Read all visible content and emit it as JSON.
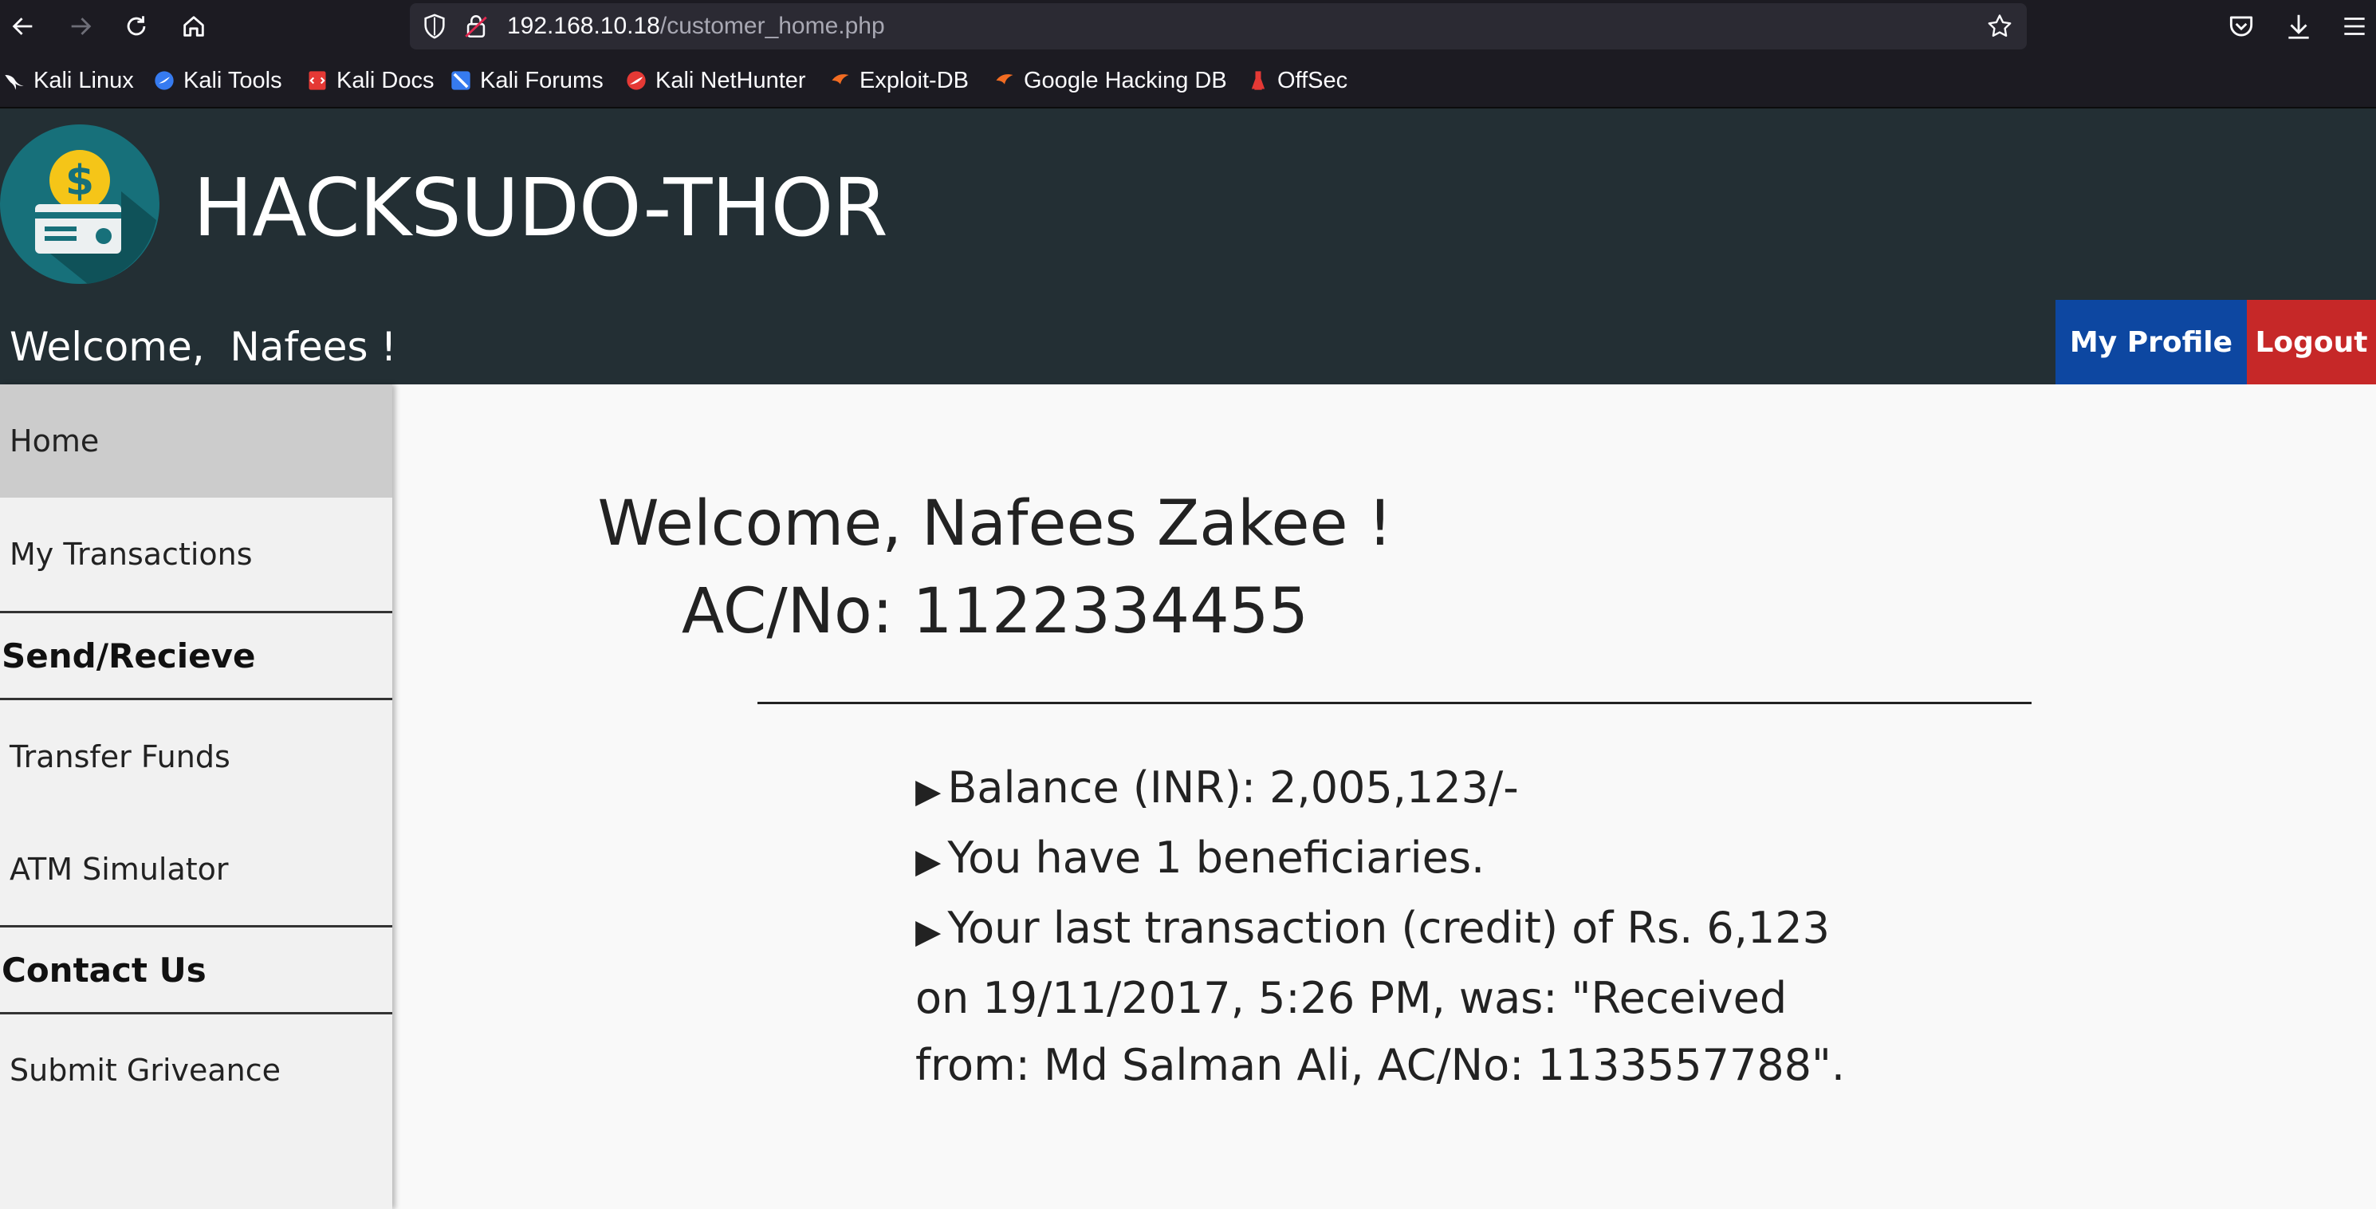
{
  "browser": {
    "url_host": "192.168.10.18",
    "url_path": "/customer_home.php",
    "bookmarks": [
      {
        "label": "Kali Linux",
        "icon": "kali-dragon-icon"
      },
      {
        "label": "Kali Tools",
        "icon": "kali-tools-icon"
      },
      {
        "label": "Kali Docs",
        "icon": "kali-docs-icon"
      },
      {
        "label": "Kali Forums",
        "icon": "kali-forums-icon"
      },
      {
        "label": "Kali NetHunter",
        "icon": "nethunter-icon"
      },
      {
        "label": "Exploit-DB",
        "icon": "exploit-db-icon"
      },
      {
        "label": "Google Hacking DB",
        "icon": "ghdb-icon"
      },
      {
        "label": "OffSec",
        "icon": "offsec-icon"
      }
    ]
  },
  "header": {
    "title": "HACKSUDO-THOR",
    "welcome": "Welcome,  Nafees !",
    "profile_label": "My Profile",
    "logout_label": "Logout",
    "colors": {
      "header_bg": "#232f34",
      "profile_bg": "#0d47a1",
      "logout_bg": "#c62828"
    }
  },
  "sidebar": {
    "items": [
      {
        "label": "Home",
        "active": true
      },
      {
        "label": "My Transactions"
      }
    ],
    "section_send": "Send/Recieve",
    "send_items": [
      "Transfer Funds",
      "ATM Simulator"
    ],
    "section_contact": "Contact Us",
    "contact_items": [
      "Submit Griveance"
    ]
  },
  "main": {
    "greeting": "Welcome, Nafees Zakee !",
    "account": "AC/No: 1122334455",
    "balance": "Balance (INR): 2,005,123/-",
    "beneficiaries": "You have 1 beneficiaries.",
    "last_tx_line1": "Your last transaction (credit) of Rs. 6,123",
    "last_tx_line2": "on 19/11/2017, 5:26 PM, was: \"Received",
    "last_tx_line3": "from: Md Salman Ali, AC/No: 1133557788\"."
  }
}
